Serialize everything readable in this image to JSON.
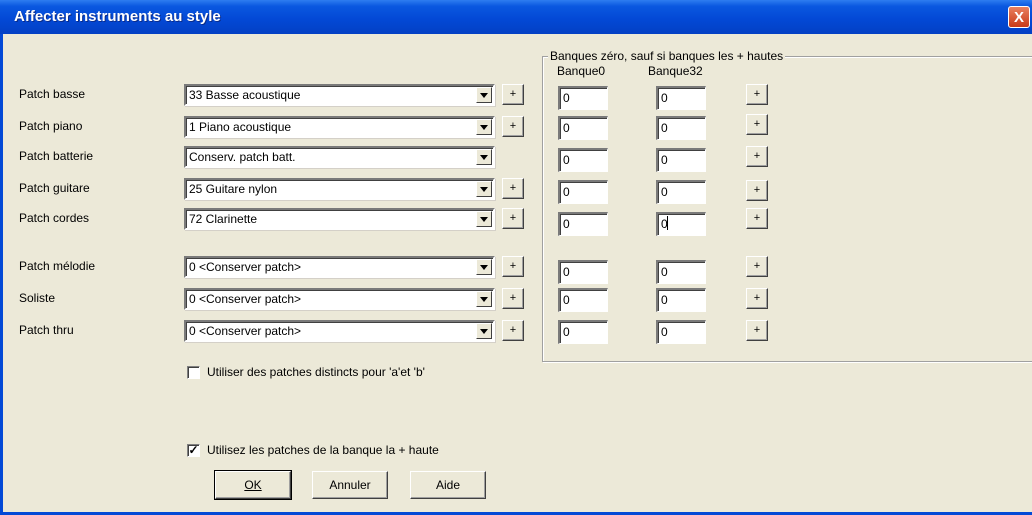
{
  "window": {
    "title": "Affecter instruments au style",
    "close_label": "X"
  },
  "rows": [
    {
      "label": "Patch basse",
      "patch": "33 Basse acoustique",
      "has_plus": true,
      "banque0": "0",
      "banque32": "0"
    },
    {
      "label": "Patch piano",
      "patch": "1 Piano acoustique",
      "has_plus": true,
      "banque0": "0",
      "banque32": "0"
    },
    {
      "label": "Patch batterie",
      "patch": "Conserv. patch batt.",
      "has_plus": false,
      "banque0": "0",
      "banque32": "0"
    },
    {
      "label": "Patch guitare",
      "patch": "25 Guitare nylon",
      "has_plus": true,
      "banque0": "0",
      "banque32": "0"
    },
    {
      "label": "Patch cordes",
      "patch": "72 Clarinette",
      "has_plus": true,
      "banque0": "0",
      "banque32": "0"
    },
    {
      "label": "Patch mélodie",
      "patch": "0 <Conserver patch>",
      "has_plus": true,
      "banque0": "0",
      "banque32": "0"
    },
    {
      "label": "Soliste",
      "patch": "0 <Conserver patch>",
      "has_plus": true,
      "banque0": "0",
      "banque32": "0"
    },
    {
      "label": "Patch thru",
      "patch": "0 <Conserver patch>",
      "has_plus": true,
      "banque0": "0",
      "banque32": "0"
    }
  ],
  "plus_label": "+",
  "banks": {
    "group_title": "Banques zéro, sauf si banques les + hautes",
    "banque0_header": "Banque0",
    "banque32_header": "Banque32"
  },
  "options": {
    "distinct_patches": {
      "label": "Utiliser des patches distincts pour 'a'et 'b'",
      "checked": false,
      "mark": ""
    },
    "highest_bank": {
      "label": "Utilisez les patches de la banque la + haute",
      "checked": true,
      "mark": "✓"
    }
  },
  "buttons": {
    "ok": "OK",
    "annuler": "Annuler",
    "aide": "Aide"
  }
}
